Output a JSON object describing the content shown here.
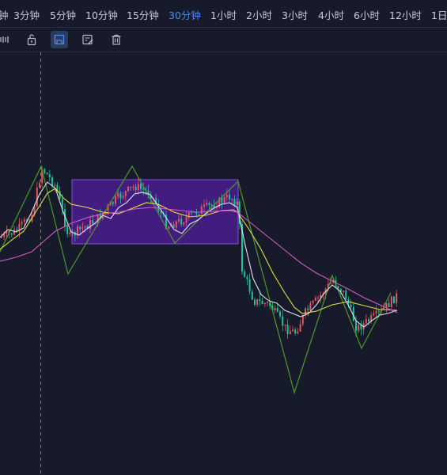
{
  "timeframes": [
    "钟",
    "3分钟",
    "5分钟",
    "10分钟",
    "15分钟",
    "30分钟",
    "1小时",
    "2小时",
    "3小时",
    "4小时",
    "6小时",
    "12小时",
    "1日"
  ],
  "active_timeframe": "30分钟",
  "toolbar": {
    "icons": [
      "link-icon",
      "lock-icon",
      "screenshot-icon",
      "edit-icon",
      "delete-icon"
    ],
    "selected": "screenshot-icon"
  },
  "colors": {
    "background": "#161a2b",
    "active": "#4c8df6",
    "up": "#e2585f",
    "down": "#1fc396",
    "rectangle_fill": "#4a1f8e",
    "rectangle_border": "#8a4fe0",
    "zigzag": "#4c9a2a",
    "ma_white": "#dfe3ee",
    "ma_yellow": "#e5e23a",
    "ma_pink": "#d65cc3",
    "crosshair": "#e2585f"
  }
}
